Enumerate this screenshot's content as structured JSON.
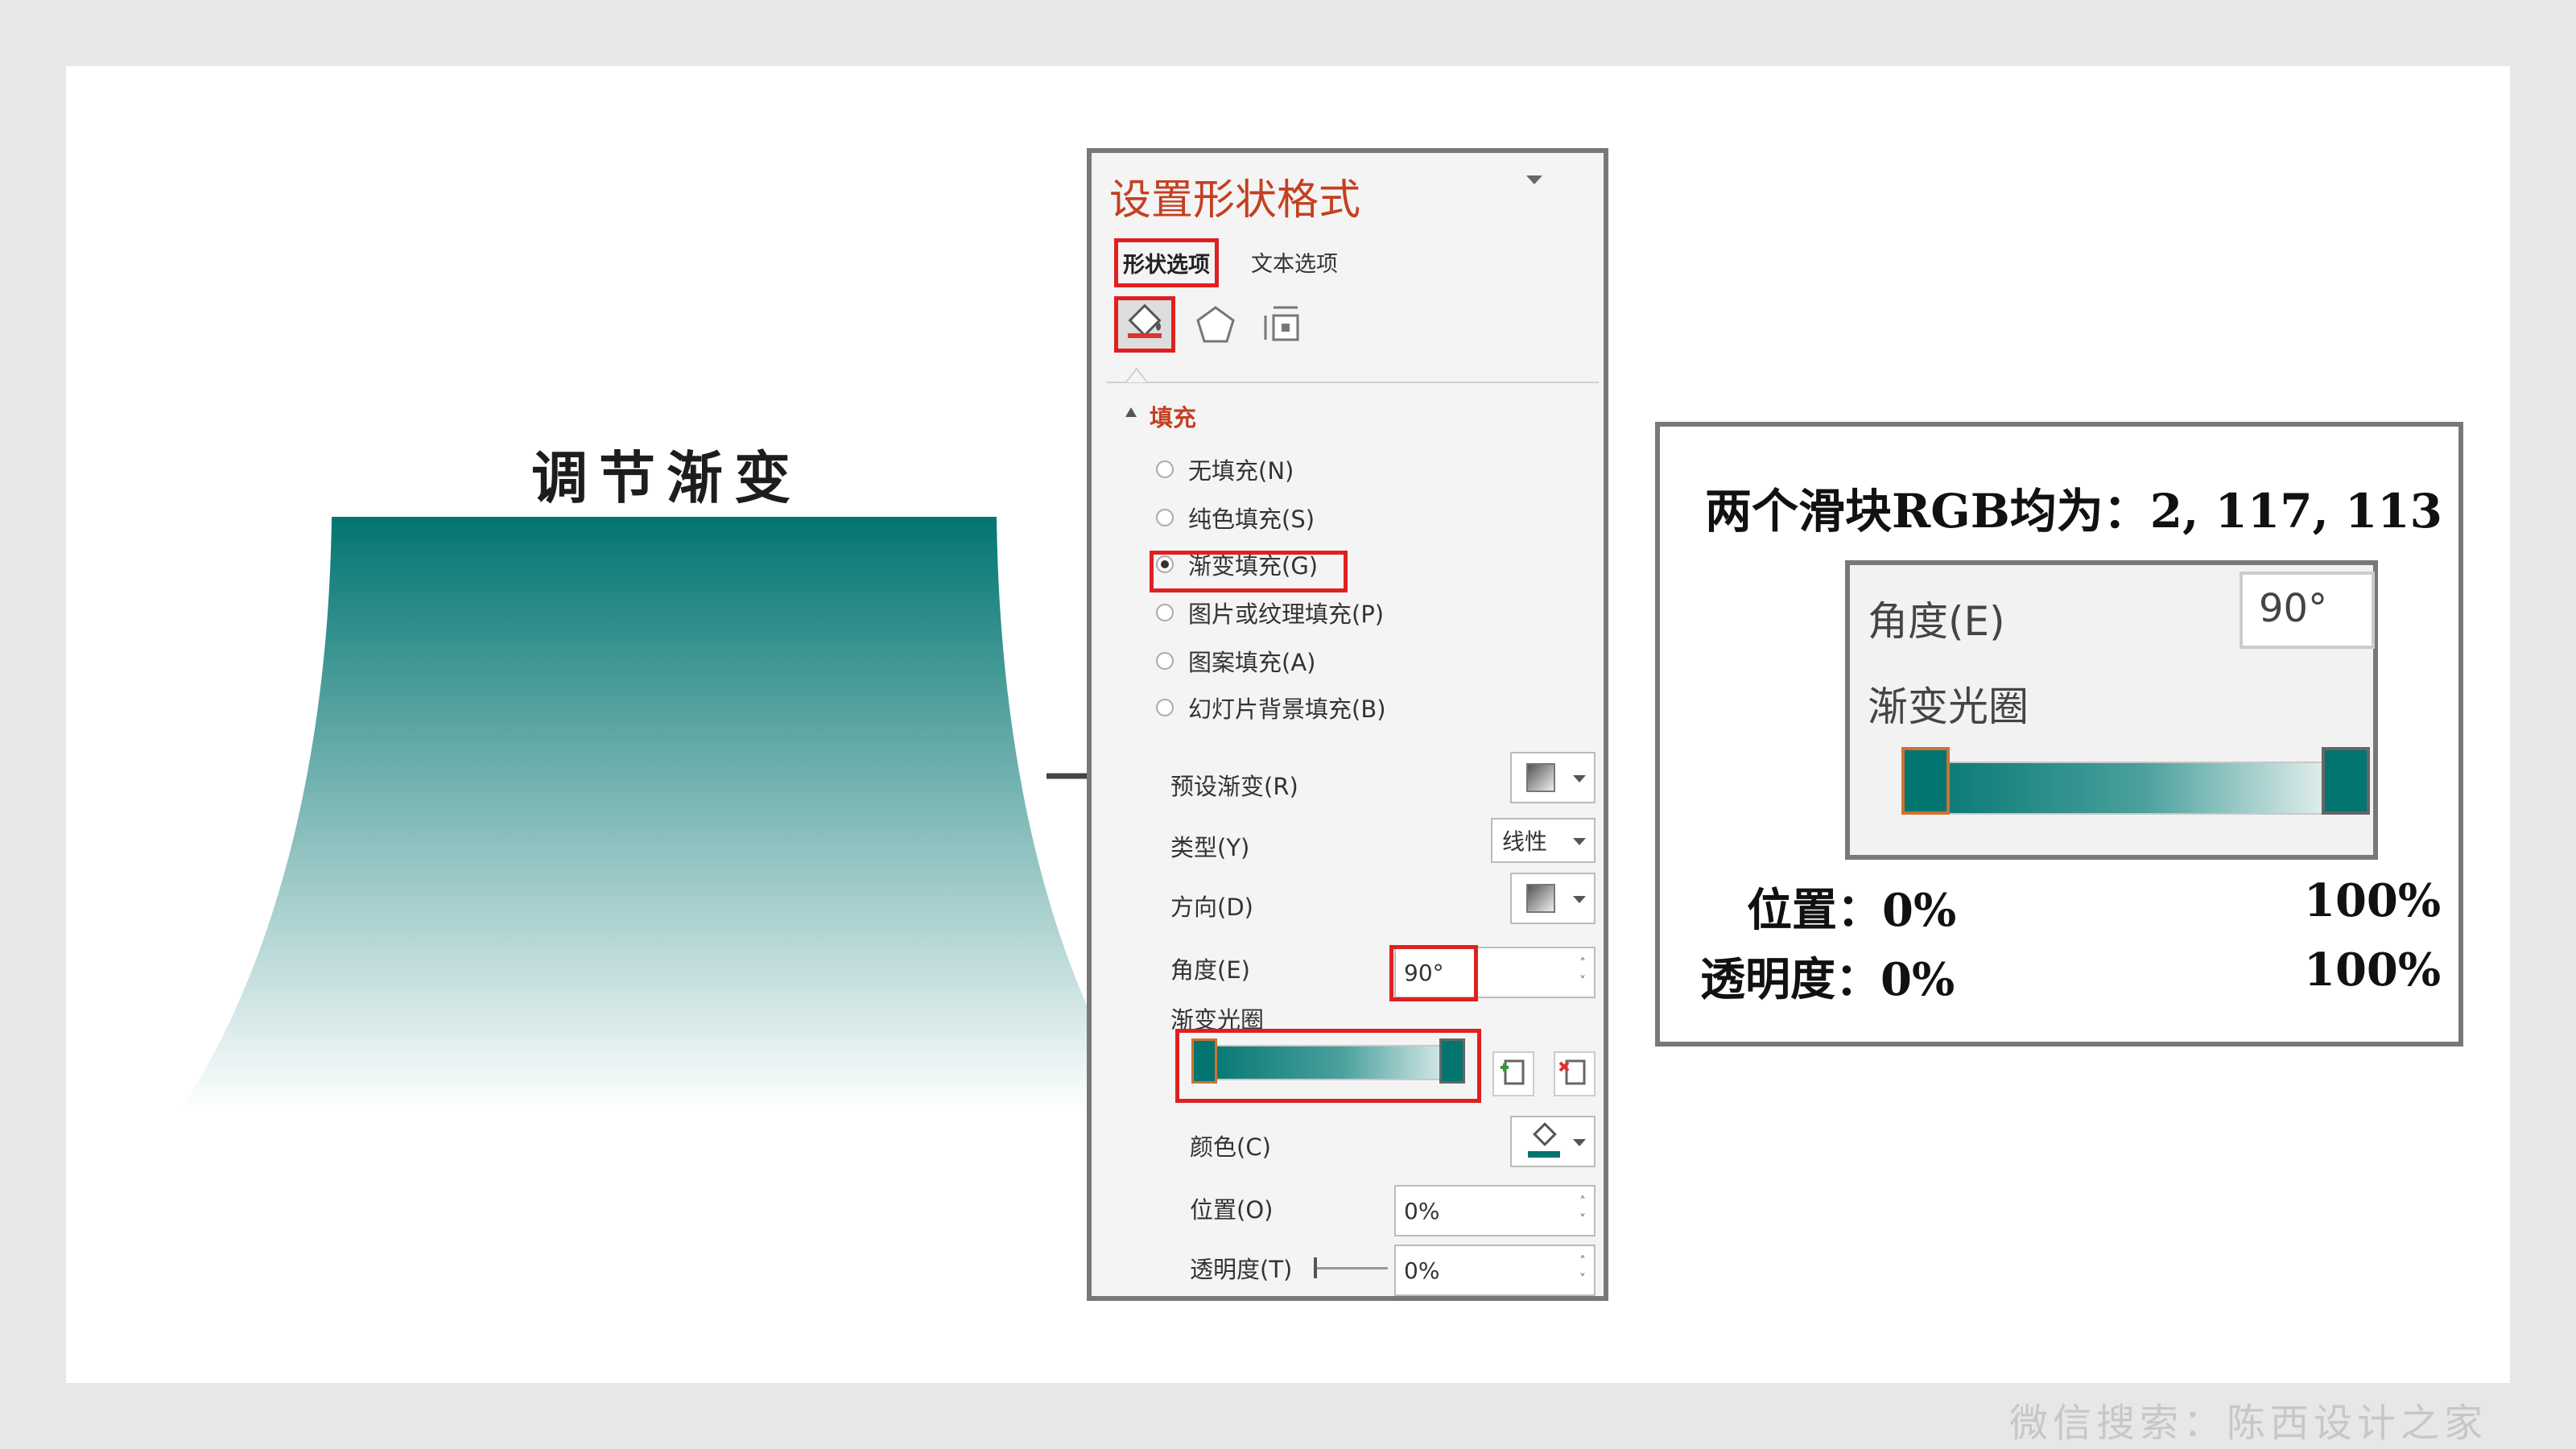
{
  "left": {
    "title": "调节渐变",
    "gradient_colors": {
      "top": "#027571",
      "bottom": "#ffffff"
    }
  },
  "panel": {
    "title": "设置形状格式",
    "tabs": [
      "形状选项",
      "文本选项"
    ],
    "icons": [
      "fill-bucket-icon",
      "pentagon-icon",
      "size-layout-icon"
    ],
    "section": "填充",
    "fill_options": [
      {
        "label": "无填充(N)",
        "selected": false
      },
      {
        "label": "纯色填充(S)",
        "selected": false
      },
      {
        "label": "渐变填充(G)",
        "selected": true
      },
      {
        "label": "图片或纹理填充(P)",
        "selected": false
      },
      {
        "label": "图案填充(A)",
        "selected": false
      },
      {
        "label": "幻灯片背景填充(B)",
        "selected": false
      }
    ],
    "preset_label": "预设渐变(R)",
    "type_label": "类型(Y)",
    "type_value": "线性",
    "direction_label": "方向(D)",
    "angle_label": "角度(E)",
    "angle_value": "90°",
    "gradient_stops_label": "渐变光圈",
    "color_label": "颜色(C)",
    "position_label": "位置(O)",
    "position_value": "0%",
    "transparency_label": "透明度(T)",
    "transparency_value": "0%"
  },
  "annotation": {
    "heading": "两个滑块RGB均为：2, 117, 113",
    "inset_angle_label": "角度(E)",
    "inset_angle_value": "90°",
    "inset_gradient_label": "渐变光圈",
    "position_left": "位置：0%",
    "position_right": "100%",
    "transparency_left": "透明度：0%",
    "transparency_right": "100%"
  },
  "colors": {
    "accent_red": "#e02020",
    "title_red": "#c44021",
    "teal": "#027571"
  },
  "watermark": "微信搜索：陈西设计之家"
}
